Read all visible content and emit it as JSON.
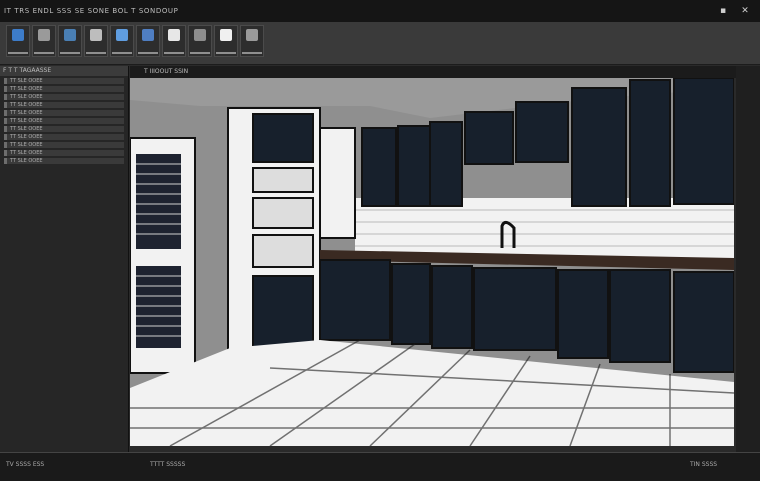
{
  "window": {
    "title": "IT TRS ENDL SSS SE SONE BOL T SONDOUP"
  },
  "ribbon": {
    "buttons": [
      {
        "name": "ie-button",
        "icon": "globe-icon",
        "color": "#3d7cc9"
      },
      {
        "name": "edit-button",
        "icon": "pen-icon",
        "color": "#9a9a9a"
      },
      {
        "name": "refresh-button",
        "icon": "refresh-icon",
        "color": "#4a7fb4"
      },
      {
        "name": "layers-button",
        "icon": "layers-icon",
        "color": "#bdbdbd"
      },
      {
        "name": "browser-button",
        "icon": "browser-icon",
        "color": "#5f9de0"
      },
      {
        "name": "document-button",
        "icon": "document-icon",
        "color": "#4f7ec2"
      },
      {
        "name": "clock-button",
        "icon": "clock-icon",
        "color": "#e7e7e7"
      },
      {
        "name": "grid-button",
        "icon": "grid-icon",
        "color": "#8d8d8d"
      },
      {
        "name": "page-button",
        "icon": "page-icon",
        "color": "#f0f0f0"
      },
      {
        "name": "panel-button",
        "icon": "panel-icon",
        "color": "#9a9a9a"
      }
    ]
  },
  "leftpanel": {
    "header": "F T T TAGAASSE",
    "rows": [
      "TT SLE OOEE",
      "TT SLE OOEE",
      "TT SLE OOEE",
      "TT SLE OOEE",
      "TT SLE OOEE",
      "TT SLE OOEE",
      "TT SLE OOEE",
      "TT SLE OOEE",
      "TT SLE OOEE",
      "TT SLE OOEE",
      "TT SLE OOEE"
    ]
  },
  "viewport": {
    "header": "T IIIOOUT SSIN",
    "scene": "kitchen render"
  },
  "status": {
    "left": "TV SSSS ESS",
    "center": "TTTT SSSSS",
    "right": "TIN SSSS"
  }
}
